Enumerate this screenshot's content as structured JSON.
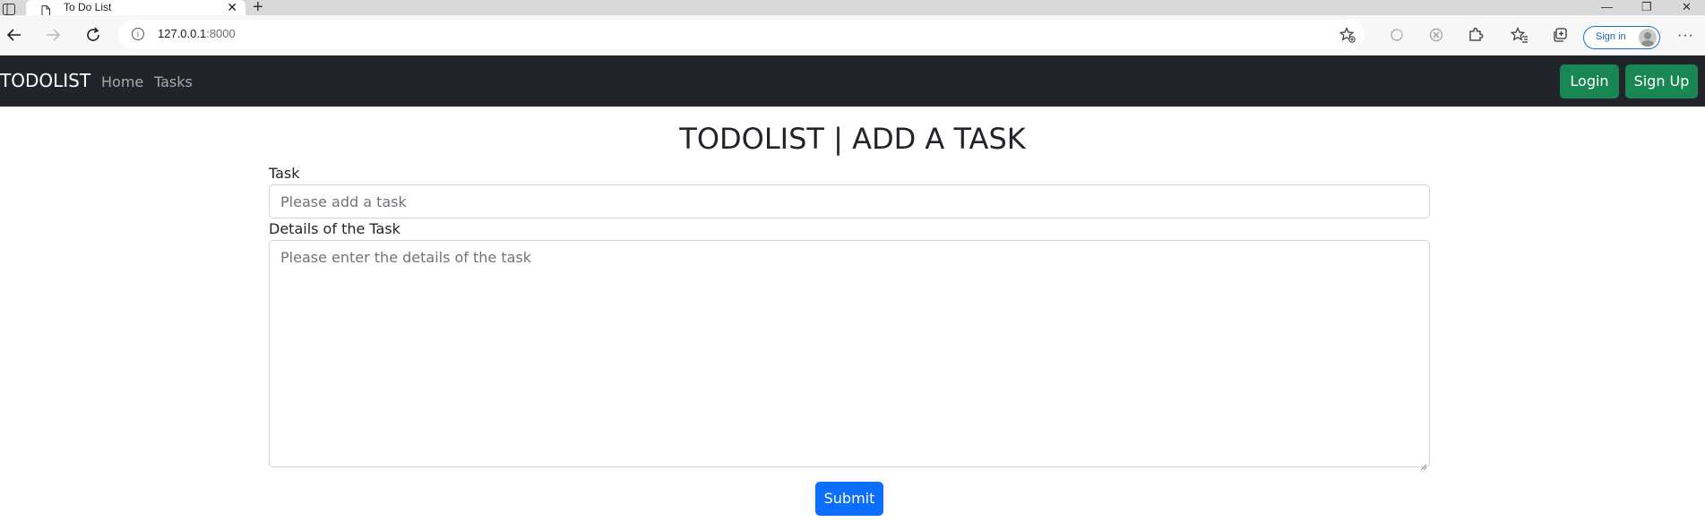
{
  "browser": {
    "tab_title": "To Do List",
    "tab_close": "✕",
    "new_tab": "+",
    "address_host": "127.0.0.1",
    "address_port": ":8000",
    "signin_label": "Sign in",
    "more": "···",
    "window_minimize": "—",
    "window_restore": "❐",
    "window_close": "✕"
  },
  "navbar": {
    "brand": "TODOLIST",
    "links": [
      "Home",
      "Tasks"
    ],
    "login": "Login",
    "signup": "Sign Up"
  },
  "page": {
    "title": "TODOLIST | ADD A TASK",
    "task_label": "Task",
    "task_placeholder": "Please add a task",
    "details_label": "Details of the Task",
    "details_placeholder": "Please enter the details of the task",
    "submit": "Submit"
  },
  "colors": {
    "navbar_bg": "#212529",
    "success_green": "#198754",
    "primary_blue": "#0d6efd"
  }
}
